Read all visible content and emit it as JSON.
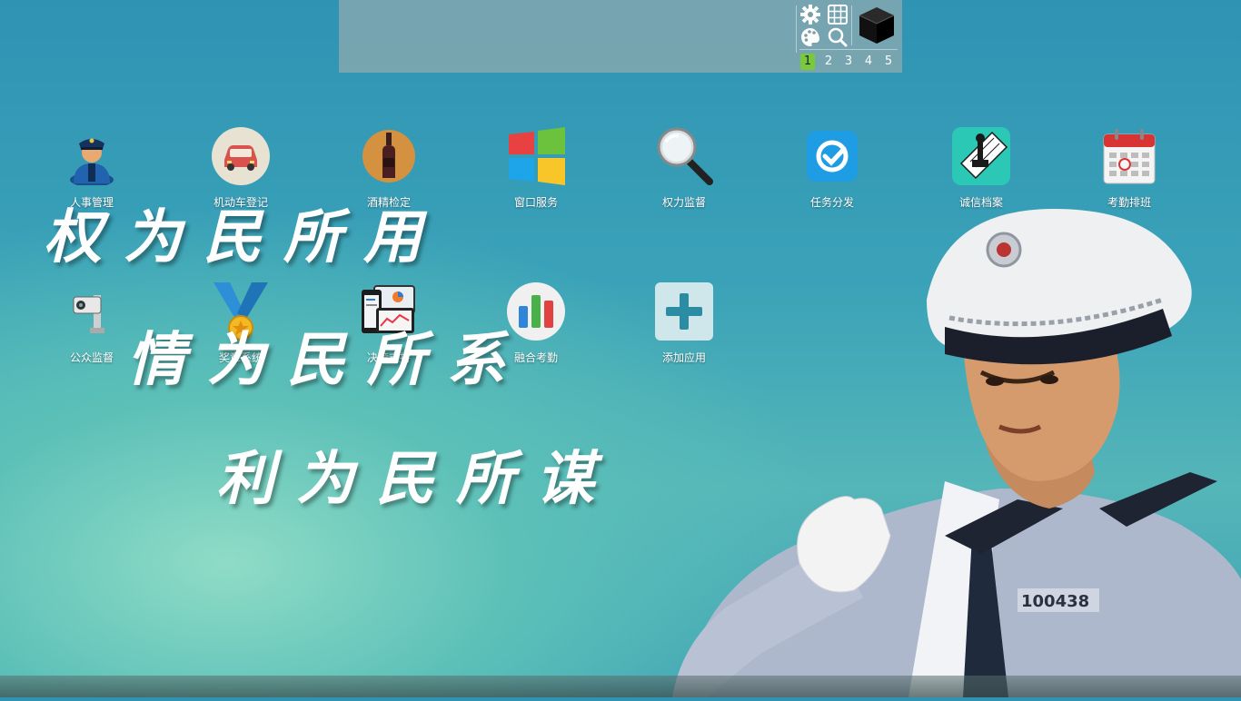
{
  "toolbar": {
    "icons": [
      "gear-icon",
      "grid-icon",
      "cube-icon",
      "palette-icon",
      "search-icon"
    ],
    "pages": [
      "1",
      "2",
      "3",
      "4",
      "5"
    ],
    "active_page": "1"
  },
  "apps_row1": [
    {
      "label": "人事管理",
      "icon": "police-officer-icon"
    },
    {
      "label": "机动车登记",
      "icon": "car-icon"
    },
    {
      "label": "酒精检定",
      "icon": "bottle-icon"
    },
    {
      "label": "窗口服务",
      "icon": "windows-icon"
    },
    {
      "label": "权力监督",
      "icon": "magnifier-icon"
    },
    {
      "label": "任务分发",
      "icon": "checkmark-icon"
    },
    {
      "label": "诚信档案",
      "icon": "stamp-icon"
    },
    {
      "label": "考勤排班",
      "icon": "calendar-icon"
    }
  ],
  "apps_row2": [
    {
      "label": "公众监督",
      "icon": "camera-icon"
    },
    {
      "label": "奖章系统",
      "icon": "medal-icon"
    },
    {
      "label": "决策支持",
      "icon": "dashboard-icon"
    },
    {
      "label": "融合考勤",
      "icon": "bar-chart-icon"
    },
    {
      "label": "添加应用",
      "icon": "plus-icon"
    }
  ],
  "slogans": {
    "line1": "权为民所用",
    "line2": "情为民所系",
    "line3": "利为民所谋"
  },
  "officer_badge_number": "100438",
  "colors": {
    "active_page": "#7ac93a",
    "bg_top": "#2f93b4",
    "bg_glow": "#8fdcc6"
  }
}
